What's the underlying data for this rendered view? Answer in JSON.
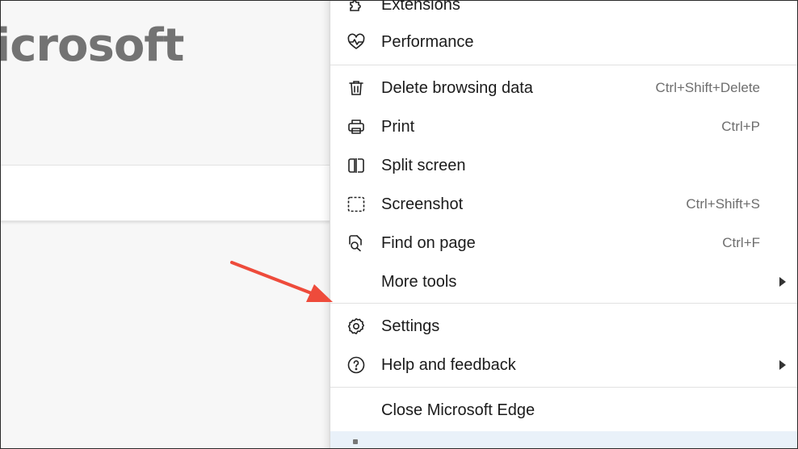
{
  "background": {
    "brand_text": "icrosoft"
  },
  "menu": {
    "items": [
      {
        "label": "Extensions",
        "shortcut": "",
        "icon": "puzzle-icon",
        "submenu": false
      },
      {
        "label": "Performance",
        "shortcut": "",
        "icon": "heartbeat-icon",
        "submenu": false
      },
      {
        "label": "Delete browsing data",
        "shortcut": "Ctrl+Shift+Delete",
        "icon": "trash-icon",
        "submenu": false
      },
      {
        "label": "Print",
        "shortcut": "Ctrl+P",
        "icon": "printer-icon",
        "submenu": false
      },
      {
        "label": "Split screen",
        "shortcut": "",
        "icon": "split-screen-icon",
        "submenu": false
      },
      {
        "label": "Screenshot",
        "shortcut": "Ctrl+Shift+S",
        "icon": "screenshot-scissors-icon",
        "submenu": false
      },
      {
        "label": "Find on page",
        "shortcut": "Ctrl+F",
        "icon": "find-page-icon",
        "submenu": false
      },
      {
        "label": "More tools",
        "shortcut": "",
        "icon": "",
        "submenu": true
      },
      {
        "label": "Settings",
        "shortcut": "",
        "icon": "gear-icon",
        "submenu": false
      },
      {
        "label": "Help and feedback",
        "shortcut": "",
        "icon": "help-icon",
        "submenu": true
      },
      {
        "label": "Close Microsoft Edge",
        "shortcut": "",
        "icon": "",
        "submenu": false
      }
    ]
  },
  "colors": {
    "arrow": "#ee4b3b",
    "shortcut_text": "#6e6e6e",
    "highlight_strip": "#e9f1f9"
  }
}
